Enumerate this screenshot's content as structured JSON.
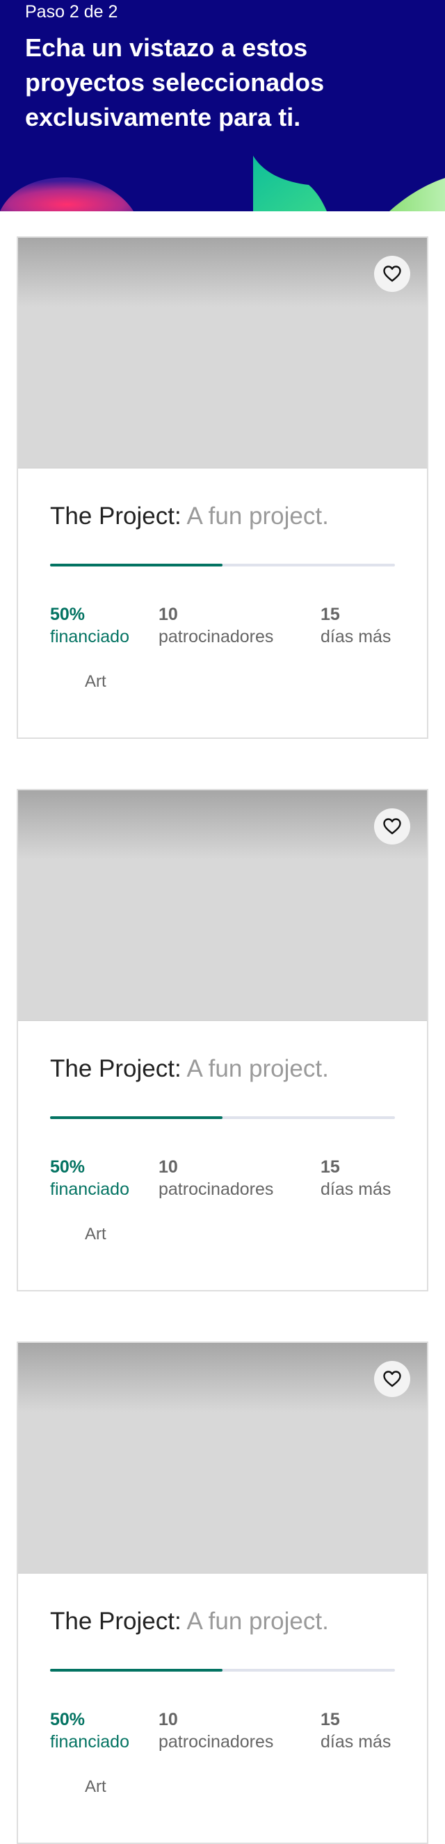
{
  "header": {
    "step": "Paso 2 de 2",
    "title": "Echa un vistazo a estos proyectos seleccionados exclusivamente para ti."
  },
  "colors": {
    "header_bg": "#0a0580",
    "funded_green": "#037362",
    "progress_track": "#dfe2ec"
  },
  "projects": [
    {
      "name": "The Project:",
      "tagline": "A fun project.",
      "progress_fraction": 0.5,
      "funded_value": "50%",
      "funded_label": "financiado",
      "backers_value": "10",
      "backers_label": "patrocinadores",
      "days_value": "15",
      "days_label": "días más",
      "category": "Art",
      "favorite_icon": "heart-outline-icon"
    },
    {
      "name": "The Project:",
      "tagline": "A fun project.",
      "progress_fraction": 0.5,
      "funded_value": "50%",
      "funded_label": "financiado",
      "backers_value": "10",
      "backers_label": "patrocinadores",
      "days_value": "15",
      "days_label": "días más",
      "category": "Art",
      "favorite_icon": "heart-outline-icon"
    },
    {
      "name": "The Project:",
      "tagline": "A fun project.",
      "progress_fraction": 0.5,
      "funded_value": "50%",
      "funded_label": "financiado",
      "backers_value": "10",
      "backers_label": "patrocinadores",
      "days_value": "15",
      "days_label": "días más",
      "category": "Art",
      "favorite_icon": "heart-outline-icon"
    }
  ]
}
